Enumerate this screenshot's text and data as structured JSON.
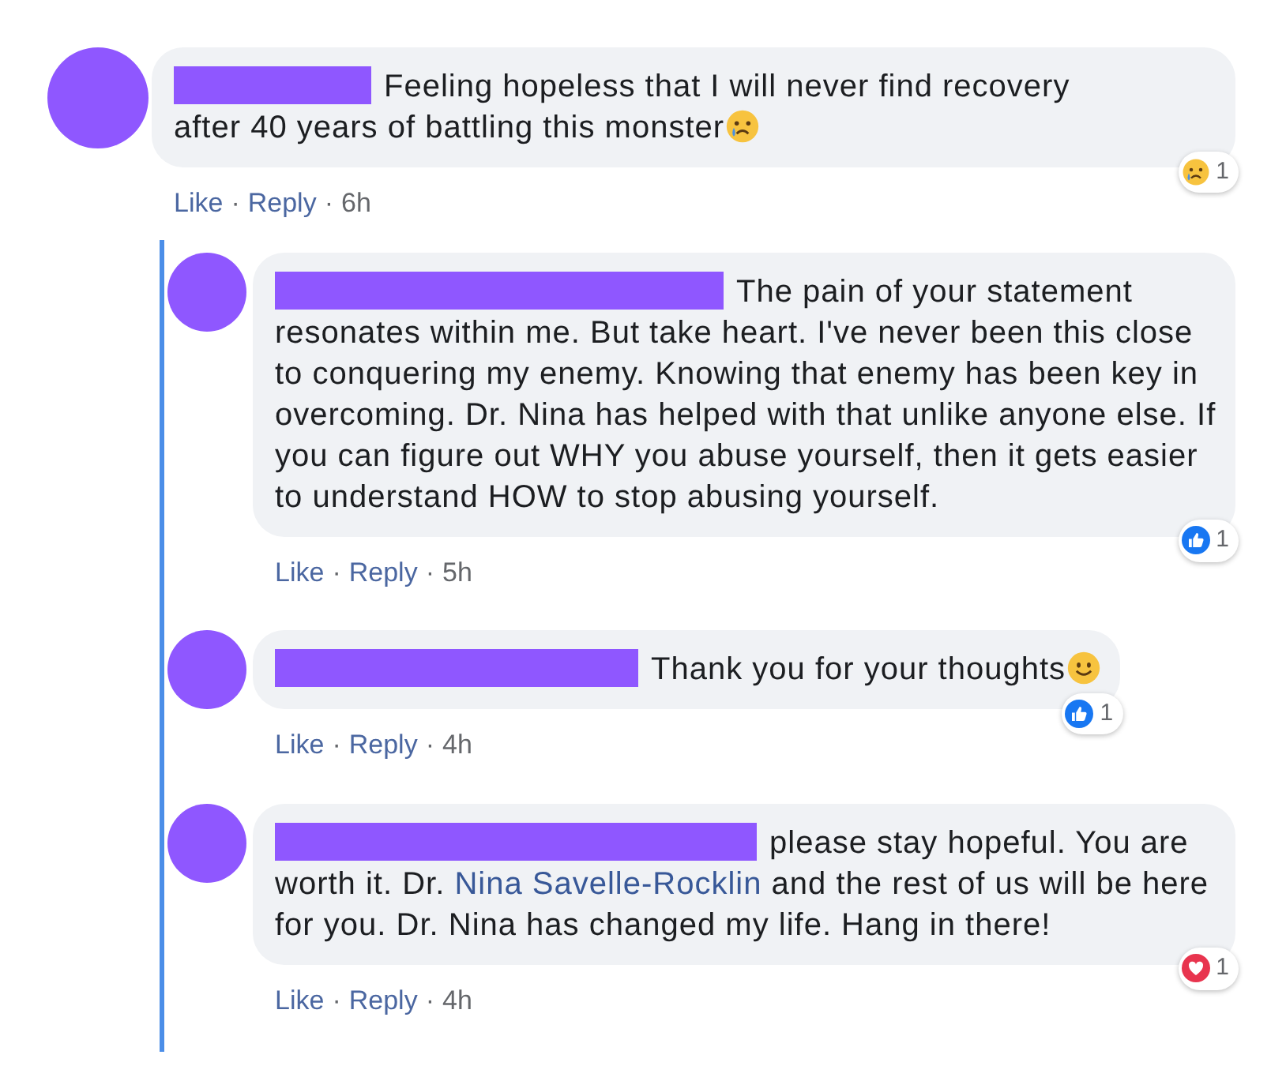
{
  "comment": {
    "redaction": {
      "kind": "short"
    },
    "segments": [
      {
        "kind": "plain",
        "text": "Feeling hopeless that I will never find recovery after 40 years of battling this monster"
      }
    ],
    "emoji": {
      "kind": "sad"
    },
    "actions": [
      "Like",
      "Reply"
    ],
    "separator": "·",
    "time": "6h",
    "reaction": {
      "kind": "sad",
      "count": "1"
    },
    "replies": [
      {
        "redaction": {
          "kind": "wide"
        },
        "segments": [
          {
            "kind": "plain",
            "text": "The pain of your statement resonates within me. But take heart. I've never been this close to conquering my enemy. Knowing that enemy has been key in overcoming. Dr. Nina has helped with that unlike anyone else. If you can figure out WHY you abuse yourself, then it gets easier to understand HOW to stop abusing yourself."
          }
        ],
        "actions": [
          "Like",
          "Reply"
        ],
        "separator": "·",
        "time": "5h",
        "reaction": {
          "kind": "like",
          "count": "1"
        }
      },
      {
        "redaction": {
          "kind": "medium"
        },
        "segments": [
          {
            "kind": "plain",
            "text": "Thank you for your thoughts"
          }
        ],
        "emoji": {
          "kind": "smile"
        },
        "actions": [
          "Like",
          "Reply"
        ],
        "separator": "·",
        "time": "4h",
        "reaction": {
          "kind": "like",
          "count": "1"
        }
      },
      {
        "redaction": {
          "kind": "long"
        },
        "segments": [
          {
            "kind": "plain",
            "text": "please stay hopeful. You are worth it. Dr. "
          },
          {
            "kind": "link",
            "text": "Nina Savelle-Rocklin"
          },
          {
            "kind": "plain",
            "text": " and the rest of us will be here for you. Dr. Nina has changed my life. Hang in there!"
          }
        ],
        "actions": [
          "Like",
          "Reply"
        ],
        "separator": "·",
        "time": "4h",
        "reaction": {
          "kind": "love",
          "count": "1"
        }
      }
    ]
  }
}
